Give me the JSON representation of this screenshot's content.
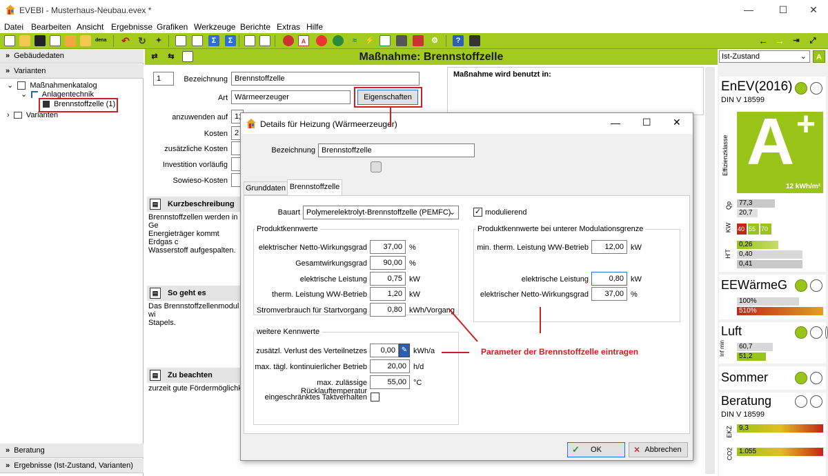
{
  "window": {
    "title": "EVEBI - Musterhaus-Neubau.evex *",
    "minimize": "—",
    "maximize": "☐",
    "close": "✕"
  },
  "menu": [
    "Datei",
    "Bearbeiten",
    "Ansicht",
    "Ergebnisse",
    "Grafiken",
    "Werkzeuge",
    "Berichte",
    "Extras",
    "Hilfe"
  ],
  "left": {
    "gebaeudedaten": "Gebäudedaten",
    "varianten_header": "Varianten",
    "tree": {
      "katalog": "Maßnahmenkatalog",
      "anlagentechnik": "Anlagentechnik",
      "brennstoffzelle": "Brennstoffzelle (1)",
      "varianten": "Varianten"
    },
    "beratung": "Beratung",
    "ergebnisse": "Ergebnisse (Ist-Zustand, Varianten)"
  },
  "main": {
    "heading": "Maßnahme: Brennstoffzelle",
    "number": "1",
    "bezeichnung_label": "Bezeichnung",
    "bezeichnung": "Brennstoffzelle",
    "art_label": "Art",
    "art": "Wärmeerzeuger",
    "eigenschaften": "Eigenschaften",
    "anzuwenden_label": "anzuwenden auf",
    "anzuwenden": "1;",
    "kosten_label": "Kosten",
    "kosten": "2",
    "zus_kosten_label": "zusätzliche Kosten",
    "investition_label": "Investition vorläufig",
    "sowieso_label": "Sowieso-Kosten",
    "benutzt_label": "Maßnahme wird benutzt in:",
    "kurz_head": "Kurzbeschreibung",
    "kurz_text": "Brennstoffzellen werden in Ge\nEnergieträger kommt Erdgas c\nWasserstoff aufgespalten.",
    "sogehts_head": "So geht es",
    "sogehts_text": "Das Brennstoffzellenmodul wi\nStapels.",
    "beachten_head": "Zu beachten",
    "beachten_text": "zurzeit gute Fördermöglichkei"
  },
  "right": {
    "zustand": "Ist-Zustand",
    "enev": "EnEV(2016)",
    "din1": "DIN V 18599",
    "effizienz": "Effizienzklasse",
    "klasse": "A",
    "klasse_plus": "+",
    "kwh": "12 kWh/m²",
    "qp_label": "Qp",
    "qp": [
      "77,3",
      "20,7"
    ],
    "kw_label": "KW",
    "kw": [
      "40",
      "55",
      "70"
    ],
    "ht_label": "H'T",
    "ht": [
      "0,26",
      "0,40",
      "0,41"
    ],
    "eewg": "EEWärmeG",
    "eewg_vals": [
      "100%",
      "510%"
    ],
    "luft": "Luft",
    "luft_label": "Inf min",
    "luft_vals": [
      "60,7",
      "51,2"
    ],
    "sommer": "Sommer",
    "beratung": "Beratung",
    "din2": "DIN V 18599",
    "ekz_label": "EKZ",
    "ekz": "9,3",
    "co2_label": "CO2",
    "co2": "1.055"
  },
  "dialog": {
    "title": "Details für Heizung  (Wärmeerzeuger)",
    "bezeichnung_label": "Bezeichnung",
    "bezeichnung": "Brennstoffzelle",
    "tabs": [
      "Grunddaten",
      "Brennstoffzelle"
    ],
    "bauart_label": "Bauart",
    "bauart": "Polymerelektrolyt-Brennstoffzelle (PEMFC)",
    "modulierend": "modulierend",
    "produkt_title": "Produktkennwerte",
    "produkt": [
      {
        "label": "elektrischer Netto-Wirkungsgrad",
        "value": "37,00",
        "unit": "%"
      },
      {
        "label": "Gesamtwirkungsgrad",
        "value": "90,00",
        "unit": "%"
      },
      {
        "label": "elektrische Leistung",
        "value": "0,75",
        "unit": "kW"
      },
      {
        "label": "therm. Leistung WW-Betrieb",
        "value": "1,20",
        "unit": "kW"
      },
      {
        "label": "Stromverbrauch für Startvorgang",
        "value": "0,80",
        "unit": "kWh/Vorgang"
      }
    ],
    "modul_title": "Produktkennwerte bei unterer Modulationsgrenze",
    "modul": [
      {
        "label": "min. therm. Leistung WW-Betrieb",
        "value": "12,00",
        "unit": "kW"
      },
      {
        "label": "elektrische Leistung",
        "value": "0,80",
        "unit": "kW"
      },
      {
        "label": "elektrischer Netto-Wirkungsgrad",
        "value": "37,00",
        "unit": "%"
      }
    ],
    "weitere_title": "weitere Kennwerte",
    "weitere": [
      {
        "label": "zusätzl. Verlust des Verteilnetzes",
        "value": "0,00",
        "unit": "kWh/a"
      },
      {
        "label": "max. tägl. kontinuierlicher Betrieb",
        "value": "20,00",
        "unit": "h/d"
      },
      {
        "label": "max. zulässige Rücklauftemperatur",
        "value": "55,00",
        "unit": "°C"
      }
    ],
    "takt": "eingeschränktes Taktverhalten",
    "ok": "OK",
    "abbrechen": "Abbrechen"
  },
  "annotation": "Parameter der Brennstoffzelle eintragen"
}
